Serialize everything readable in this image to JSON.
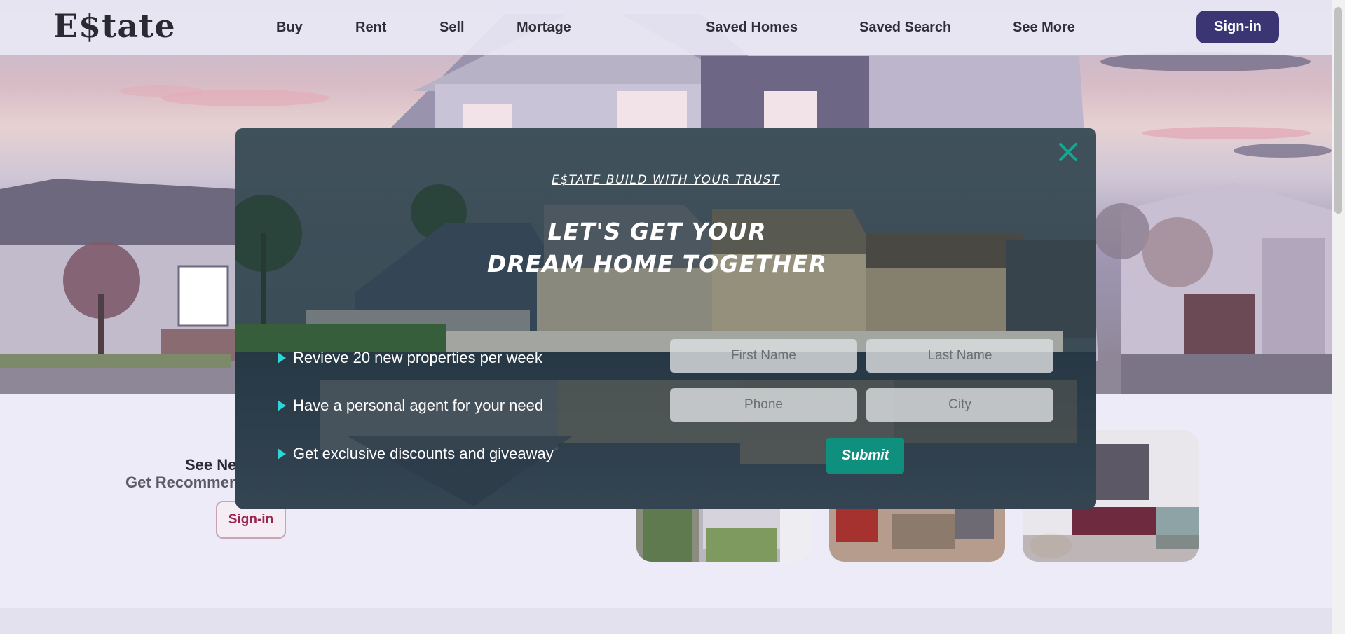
{
  "header": {
    "logo": "E$tate",
    "nav": [
      "Buy",
      "Rent",
      "Sell",
      "Mortage",
      "Saved Homes",
      "Saved Search",
      "See More"
    ],
    "signin_label": "Sign-in"
  },
  "promo": {
    "title": "See Ne",
    "subtitle": "Get Recommer",
    "signin_label": "Sign-in"
  },
  "modal": {
    "tagline": "E$TATE BUILD WITH YOUR TRUST",
    "headline_line1": "LET'S GET YOUR",
    "headline_line2": "DREAM HOME TOGETHER",
    "features": [
      "Revieve 20 new properties per week",
      "Have a personal agent for your need",
      "Get exclusive discounts and giveaway"
    ],
    "form": {
      "first_name_placeholder": "First Name",
      "last_name_placeholder": "Last Name",
      "phone_placeholder": "Phone",
      "city_placeholder": "City",
      "submit_label": "Submit"
    }
  },
  "colors": {
    "brand": "#3b3573",
    "accent": "#0f8f7d",
    "close": "#13a88f",
    "bullet": "#2ed6d6",
    "promo_button_text": "#9b2550"
  },
  "icons": {
    "close": "close-icon",
    "bullet": "triangle-right-icon"
  }
}
